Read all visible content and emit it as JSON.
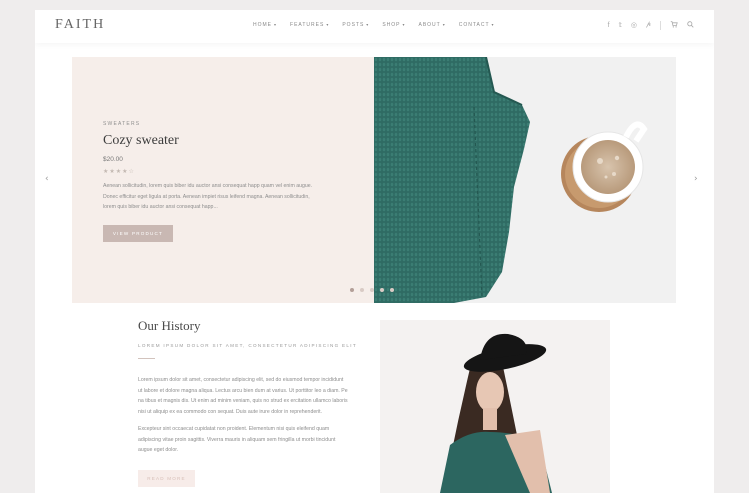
{
  "brand": {
    "logo": "FAITH"
  },
  "nav": [
    {
      "label": "HOME"
    },
    {
      "label": "FEATURES"
    },
    {
      "label": "POSTS"
    },
    {
      "label": "SHOP"
    },
    {
      "label": "ABOUT"
    },
    {
      "label": "CONTACT"
    }
  ],
  "social_icons": [
    "facebook-icon",
    "twitter-icon",
    "instagram-icon",
    "pinterest-icon",
    "cart-icon",
    "search-icon"
  ],
  "hero": {
    "category": "SWEATERS",
    "title": "Cozy sweater",
    "price": "$20.00",
    "rating": 4,
    "rating_max": 5,
    "desc_lines": [
      "Aenean sollicitudin, lorem quis biber idu auctor ansi consequat happ quam vel enim augue.",
      "Donec efficitur eget ligula at porta. Aenean impiet risus leifend magna. Aenean sollicitudin,",
      "lorem quis biber idu auctor ansi consequat happ..."
    ],
    "button": "VIEW PRODUCT",
    "slide_count": 5,
    "active_slide": 1
  },
  "history": {
    "title": "Our History",
    "subtitle": "LOREM IPSUM DOLOR SIT AMET, CONSECTETUR ADIPISCING ELIT",
    "para1_lines": [
      "Lorem ipsum dolor sit amet, consectetur adipiscing elit, sed do eiusmod tempor incididunt",
      "ut labore et dolore magna aliqua. Lectus arcu bien dum at varius. Ut porttitor leo a diam. Pe",
      "na tibus et magnis dis. Ut enim ad minim veniam, quis no strud ex ercitation ullamco laboris",
      "nisi ut aliquip ex ea commodo con sequat. Duis aute irure dolor in reprehenderit."
    ],
    "para2_lines": [
      "Excepteur sint occaecat cupidatat non proident. Elementum nisi quis eleifend quam",
      "adipiscing vitae proin sagittis. Viverra mauris in aliquam sem fringilla ut morbi tincidunt",
      "augue eget dolor."
    ],
    "button": "READ MORE"
  },
  "colors": {
    "hero_bg": "#f6eeea",
    "accent": "#c9b8b3",
    "sweater": "#2f6b63"
  }
}
